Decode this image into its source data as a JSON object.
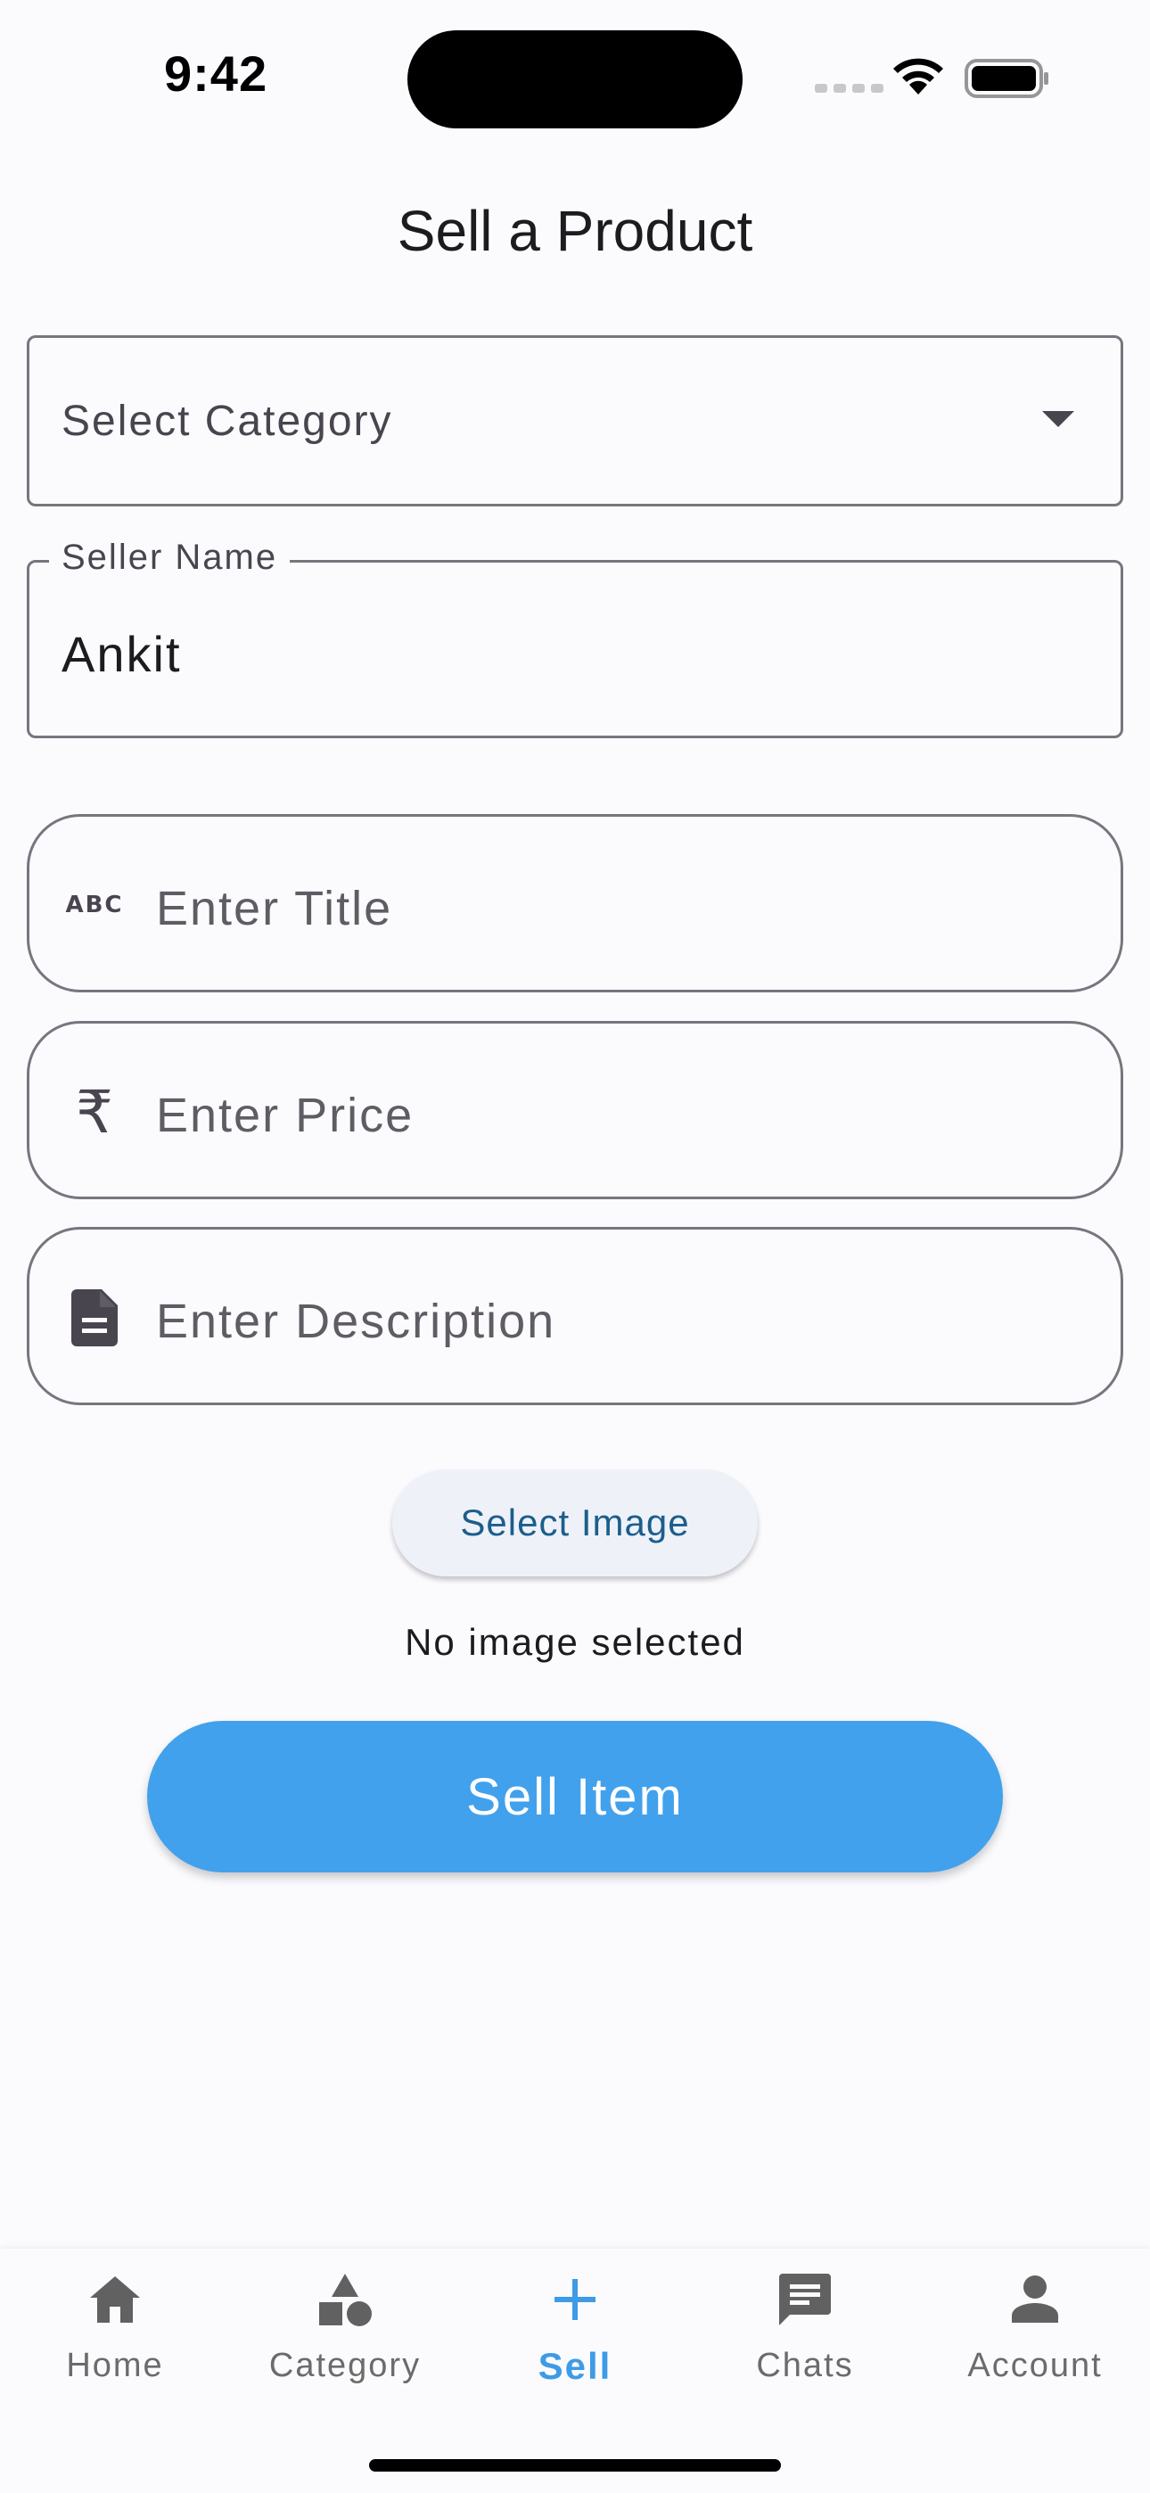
{
  "status_bar": {
    "time": "9:42"
  },
  "page": {
    "title": "Sell a Product"
  },
  "form": {
    "category_select": {
      "placeholder": "Select Category",
      "icon": "dropdown-arrow-icon"
    },
    "seller_name": {
      "label": "Seller Name",
      "value": "Ankit"
    },
    "title_field": {
      "placeholder": "Enter Title",
      "icon": "abc-icon",
      "icon_text": "ABC"
    },
    "price_field": {
      "placeholder": "Enter Price",
      "icon": "rupee-icon",
      "icon_text": "₹"
    },
    "description_field": {
      "placeholder": "Enter Description",
      "icon": "document-icon"
    },
    "select_image_label": "Select Image",
    "image_status": "No image selected",
    "submit_label": "Sell Item"
  },
  "bottom_nav": {
    "items": [
      {
        "label": "Home",
        "icon": "home-icon",
        "active": false
      },
      {
        "label": "Category",
        "icon": "category-icon",
        "active": false
      },
      {
        "label": "Sell",
        "icon": "add-icon",
        "active": true
      },
      {
        "label": "Chats",
        "icon": "chat-icon",
        "active": false
      },
      {
        "label": "Account",
        "icon": "person-icon",
        "active": false
      }
    ]
  },
  "colors": {
    "accent": "#42a1ec",
    "active_nav": "#3e9be6",
    "inactive_nav": "#6b6b6b",
    "outline": "#79747e",
    "background": "#fbfbfe"
  }
}
